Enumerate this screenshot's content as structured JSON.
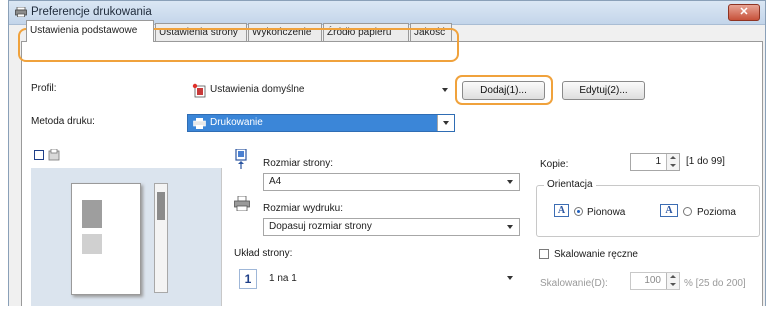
{
  "window": {
    "title": "Preferencje drukowania",
    "close_label": "✕"
  },
  "tabs": [
    {
      "label": "Ustawienia podstawowe"
    },
    {
      "label": "Ustawienia strony"
    },
    {
      "label": "Wykończenie"
    },
    {
      "label": "Źródło papieru"
    },
    {
      "label": "Jakość"
    }
  ],
  "profile": {
    "label": "Profil:",
    "value": "Ustawienia domyślne",
    "add_button": "Dodaj(1)...",
    "edit_button": "Edytuj(2)..."
  },
  "print_method": {
    "label": "Metoda druku:",
    "value": "Drukowanie"
  },
  "page_size": {
    "label": "Rozmiar strony:",
    "value": "A4"
  },
  "output_size": {
    "label": "Rozmiar wydruku:",
    "value": "Dopasuj rozmiar strony"
  },
  "page_layout": {
    "label": "Układ strony:",
    "value": "1 na 1",
    "icon_number": "1"
  },
  "copies": {
    "label": "Kopie:",
    "value": "1",
    "range": "[1 do 99]"
  },
  "orientation": {
    "label": "Orientacja",
    "options": [
      {
        "label": "Pionowa",
        "selected": true
      },
      {
        "label": "Pozioma",
        "selected": false
      }
    ],
    "icon_letter": "A"
  },
  "manual_scaling": {
    "label": "Skalowanie ręczne",
    "field_label": "Skalowanie(D):",
    "value": "100",
    "range": "% [25 do 200]"
  },
  "colors": {
    "highlight": "#f0a23c",
    "selection": "#3b86d8"
  }
}
